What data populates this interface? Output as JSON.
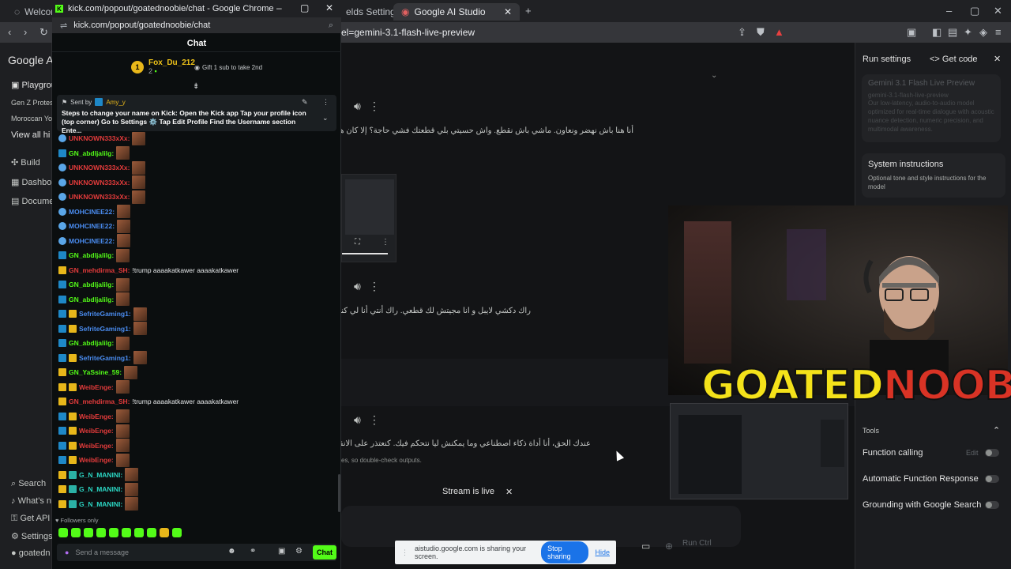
{
  "background_browser": {
    "tabs": [
      {
        "label": "Welcome t"
      },
      {
        "label": "elds Settings"
      },
      {
        "label": "Google AI Studio"
      }
    ],
    "url": "el=gemini-3.1-flash-live-preview"
  },
  "studio": {
    "left_nav": [
      {
        "label": "Google AI"
      },
      {
        "label": "Playgrou"
      },
      {
        "label": "Gen Z Protest"
      },
      {
        "label": "Moroccan You"
      },
      {
        "label": "View all hi"
      },
      {
        "label": "Build"
      },
      {
        "label": "Dashbo"
      },
      {
        "label": "Docume"
      },
      {
        "label": "Search"
      },
      {
        "label": "What's n"
      },
      {
        "label": "Get API"
      },
      {
        "label": "Settings"
      },
      {
        "label": "goatedn"
      }
    ],
    "transcripts": [
      "أنا هنا باش نهضر ونعاون. ماشي باش نقطع. واش حسيتي بلي قطعتك فشي حاجة؟ إلا كان هكاك، سمح لي. ما كانش هدفي",
      "راك دكشي لايبل و انا مجيتش لك قطعي. راك أنتي أنا لي كنتحكم فيك ماشي أنتي",
      "عندك الحق، أنا أداة ذكاء اصطناعي وما يمكنش ليا نتحكم فيك. كنعتذر على الانقطاع اللي وقع. ما كانش"
    ],
    "disclaimer": "es, so double-check outputs.",
    "right_panel": {
      "run_settings": "Run settings",
      "get_code": "Get code",
      "model_name": "Gemini 3.1 Flash Live Preview",
      "model_id": "gemini-3.1-flash-live-preview",
      "model_desc": "Our low-latency, audio-to-audio model optimized for real-time dialogue with acoustic nuance detection, numeric precision, and multimodal awareness.",
      "system_instructions": "System instructions",
      "system_instructions_desc": "Optional tone and style instructions for the model",
      "tools": "Tools",
      "function_calling": "Function calling",
      "edit": "Edit",
      "auto_function": "Automatic Function Response",
      "grounding": "Grounding with Google Search"
    },
    "run_button": "Run Ctrl"
  },
  "overlay": {
    "brand_goated": "GOATED",
    "brand_noobie": "NOOBIE",
    "stream_status": "Stream is live",
    "share_text": "aistudio.google.com is sharing your screen.",
    "stop_sharing": "Stop sharing",
    "hide": "Hide"
  },
  "popup": {
    "window_title": "kick.com/popout/goatednoobie/chat - Google Chrome",
    "url": "kick.com/popout/goatednoobie/chat",
    "chat_title": "Chat",
    "leader_rank": "1",
    "leader_name": "Fox_Du_212",
    "leader_count": "2",
    "gift_text": "Gift 1 sub to take 2nd",
    "pinned_label": "Sent by",
    "pinned_user": "Amy_y",
    "pinned_message": "Steps to change your name on Kick: Open the Kick app Tap your profile icon (top corner) Go to Settings ⚙️ Tap Edit Profile Find the Username section Ente...",
    "messages": [
      {
        "user": "UNKNOWN333xXx:",
        "color": "#e33b3b",
        "badges": [
          "og"
        ],
        "text": "",
        "emotes": 1
      },
      {
        "user": "GN_abdljalilg:",
        "color": "#53fc18",
        "badges": [
          "mod"
        ],
        "text": "",
        "emotes": 1
      },
      {
        "user": "UNKNOWN333xXx:",
        "color": "#e33b3b",
        "badges": [
          "og"
        ],
        "text": "",
        "emotes": 1
      },
      {
        "user": "UNKNOWN333xXx:",
        "color": "#e33b3b",
        "badges": [
          "og"
        ],
        "text": "",
        "emotes": 1
      },
      {
        "user": "UNKNOWN333xXx:",
        "color": "#e33b3b",
        "badges": [
          "og"
        ],
        "text": "",
        "emotes": 1
      },
      {
        "user": "MOHCINEE22:",
        "color": "#4a8cf0",
        "badges": [
          "og"
        ],
        "text": "",
        "emotes": 1
      },
      {
        "user": "MOHCINEE22:",
        "color": "#4a8cf0",
        "badges": [
          "og"
        ],
        "text": "",
        "emotes": 1
      },
      {
        "user": "MOHCINEE22:",
        "color": "#4a8cf0",
        "badges": [
          "og"
        ],
        "text": "",
        "emotes": 1
      },
      {
        "user": "GN_abdljalilg:",
        "color": "#53fc18",
        "badges": [
          "mod"
        ],
        "text": "",
        "emotes": 1
      },
      {
        "user": "GN_mehdirma_SH:",
        "color": "#e33b3b",
        "badges": [
          "vip"
        ],
        "text": "!trump aaaakatkawer aaaakatkawer",
        "emotes": 0
      },
      {
        "user": "GN_abdljalilg:",
        "color": "#53fc18",
        "badges": [
          "mod"
        ],
        "text": "",
        "emotes": 1
      },
      {
        "user": "GN_abdljalilg:",
        "color": "#53fc18",
        "badges": [
          "mod"
        ],
        "text": "",
        "emotes": 1
      },
      {
        "user": "SefriteGaming1:",
        "color": "#4a8cf0",
        "badges": [
          "mod",
          "vip"
        ],
        "text": "",
        "emotes": 1
      },
      {
        "user": "SefriteGaming1:",
        "color": "#4a8cf0",
        "badges": [
          "mod",
          "vip"
        ],
        "text": "",
        "emotes": 1
      },
      {
        "user": "GN_abdljalilg:",
        "color": "#53fc18",
        "badges": [
          "mod"
        ],
        "text": "",
        "emotes": 1
      },
      {
        "user": "SefriteGaming1:",
        "color": "#4a8cf0",
        "badges": [
          "mod",
          "vip"
        ],
        "text": "",
        "emotes": 1
      },
      {
        "user": "GN_YaSsine_59:",
        "color": "#53fc18",
        "badges": [
          "vip"
        ],
        "text": "",
        "emotes": 1
      },
      {
        "user": "WeibEnge:",
        "color": "#e33b3b",
        "badges": [
          "vip",
          "vip"
        ],
        "text": "",
        "emotes": 1
      },
      {
        "user": "GN_mehdirma_SH:",
        "color": "#e33b3b",
        "badges": [
          "vip"
        ],
        "text": "!trump aaaakatkawer aaaakatkawer",
        "emotes": 0
      },
      {
        "user": "WeibEnge:",
        "color": "#e33b3b",
        "badges": [
          "mod",
          "vip"
        ],
        "text": "",
        "emotes": 1
      },
      {
        "user": "WeibEnge:",
        "color": "#e33b3b",
        "badges": [
          "mod",
          "vip"
        ],
        "text": "",
        "emotes": 1
      },
      {
        "user": "WeibEnge:",
        "color": "#e33b3b",
        "badges": [
          "mod",
          "vip"
        ],
        "text": "",
        "emotes": 1
      },
      {
        "user": "WeibEnge:",
        "color": "#e33b3b",
        "badges": [
          "mod",
          "vip"
        ],
        "text": "",
        "emotes": 1
      },
      {
        "user": "G_N_MANINI:",
        "color": "#2bd6c3",
        "badges": [
          "vip",
          "sub"
        ],
        "text": "",
        "emotes": 1
      },
      {
        "user": "G_N_MANINI:",
        "color": "#2bd6c3",
        "badges": [
          "vip",
          "sub"
        ],
        "text": "",
        "emotes": 1
      },
      {
        "user": "G_N_MANINI:",
        "color": "#2bd6c3",
        "badges": [
          "vip",
          "sub"
        ],
        "text": "",
        "emotes": 1
      }
    ],
    "followers_only": "Followers only",
    "input_placeholder": "Send a message",
    "send_label": "Chat"
  }
}
